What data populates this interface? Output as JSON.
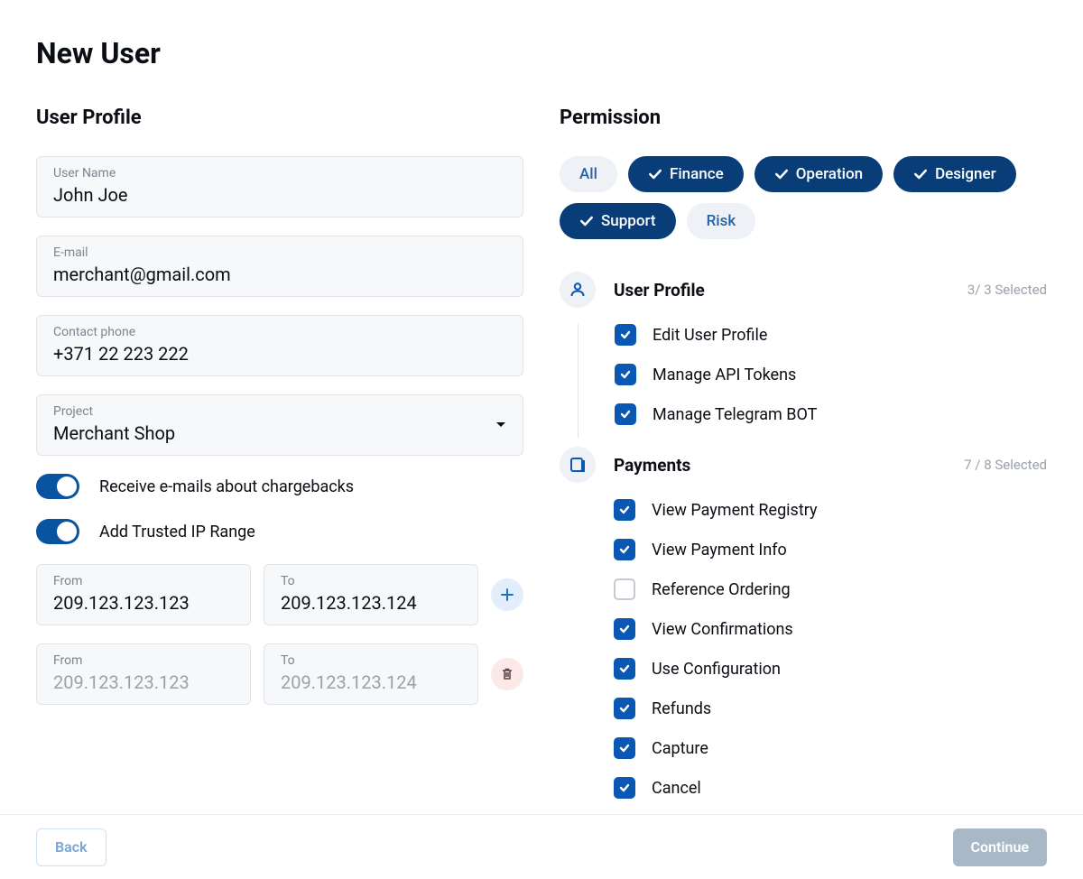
{
  "page_title": "New User",
  "profile": {
    "section_title": "User Profile",
    "fields": {
      "username": {
        "label": "User Name",
        "value": "John Joe"
      },
      "email": {
        "label": "E-mail",
        "value": "merchant@gmail.com"
      },
      "phone": {
        "label": "Contact phone",
        "value": "+371 22 223 222"
      },
      "project": {
        "label": "Project",
        "value": "Merchant Shop"
      }
    },
    "toggles": {
      "chargebacks": {
        "label": "Receive e-mails about chargebacks",
        "on": true
      },
      "ip_range": {
        "label": "Add Trusted IP Range",
        "on": true
      }
    },
    "ip_rows": [
      {
        "from_label": "From",
        "to_label": "To",
        "from": "209.123.123.123",
        "to": "209.123.123.124",
        "action": "add",
        "filled": true
      },
      {
        "from_label": "From",
        "to_label": "To",
        "from_placeholder": "209.123.123.123",
        "to_placeholder": "209.123.123.124",
        "action": "delete",
        "filled": false
      }
    ]
  },
  "permissions": {
    "section_title": "Permission",
    "roles": [
      {
        "label": "All",
        "active": false
      },
      {
        "label": "Finance",
        "active": true
      },
      {
        "label": "Operation",
        "active": true
      },
      {
        "label": "Designer",
        "active": true
      },
      {
        "label": "Support",
        "active": true
      },
      {
        "label": "Risk",
        "active": false
      }
    ],
    "groups": [
      {
        "icon": "user",
        "title": "User Profile",
        "count": "3/ 3 Selected",
        "items": [
          {
            "label": "Edit User Profile",
            "checked": true
          },
          {
            "label": "Manage API Tokens",
            "checked": true
          },
          {
            "label": "Manage Telegram BOT",
            "checked": true
          }
        ]
      },
      {
        "icon": "payments",
        "title": "Payments",
        "count": "7 / 8  Selected",
        "items": [
          {
            "label": "View Payment Registry",
            "checked": true
          },
          {
            "label": "View Payment Info",
            "checked": true
          },
          {
            "label": "Reference Ordering",
            "checked": false
          },
          {
            "label": "View Confirmations",
            "checked": true
          },
          {
            "label": "Use Configuration",
            "checked": true
          },
          {
            "label": "Refunds",
            "checked": true
          },
          {
            "label": "Capture",
            "checked": true
          },
          {
            "label": "Cancel",
            "checked": true
          }
        ]
      }
    ]
  },
  "footer": {
    "back": "Back",
    "continue": "Continue"
  }
}
